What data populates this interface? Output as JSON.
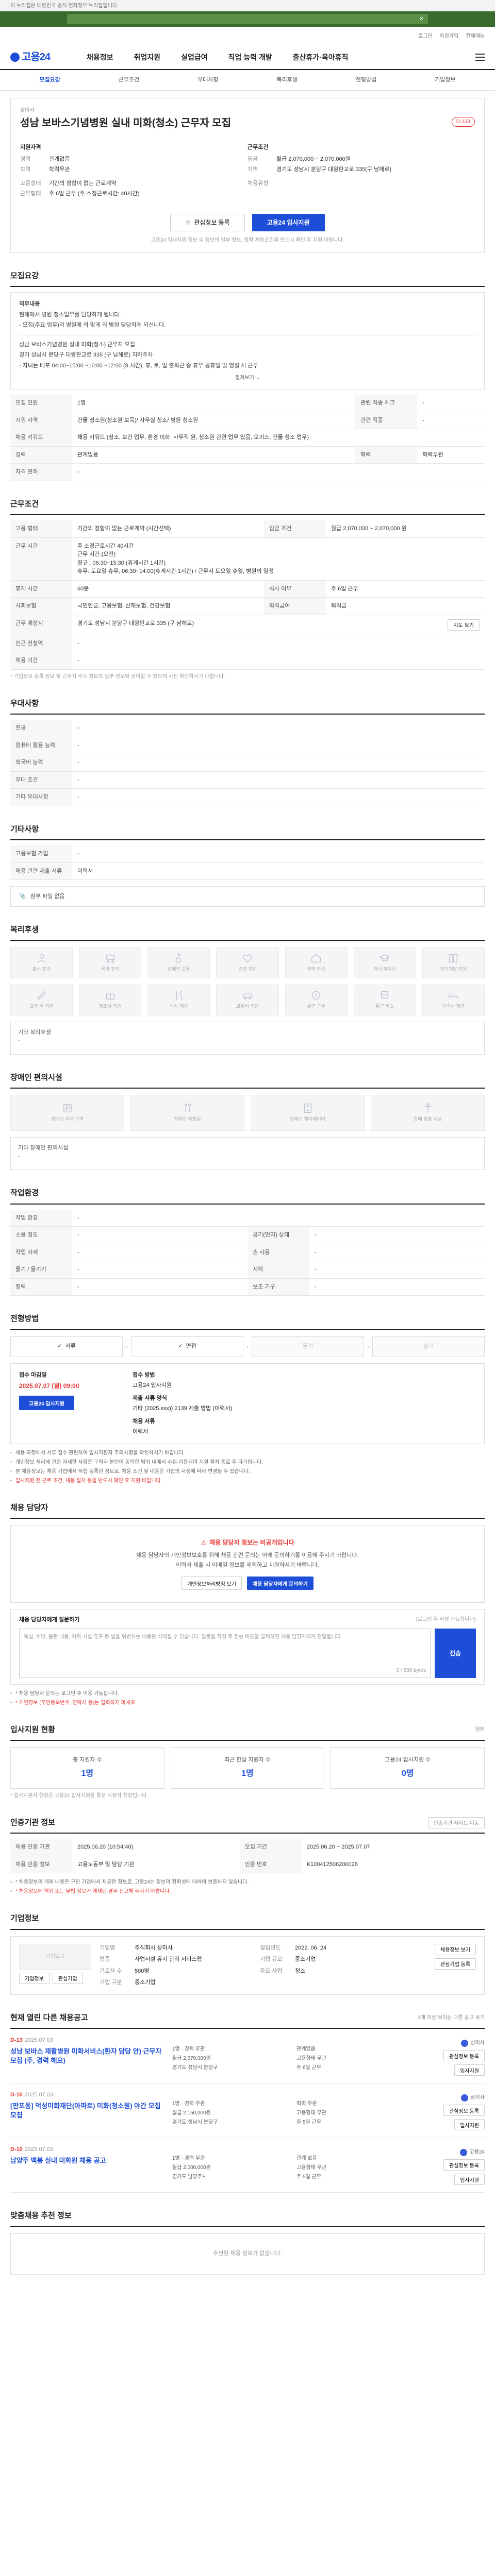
{
  "top_notice": "이 누리집은 대한민국 공식 전자정부 누리집입니다.",
  "utility": {
    "login": "로그인",
    "join": "회원가입",
    "site_map": "전체메뉴"
  },
  "header": {
    "logo": "고용24",
    "menu": [
      "채용정보",
      "취업지원",
      "실업급여",
      "직업 능력 개발",
      "출산휴가·육아휴직"
    ]
  },
  "tabnav": [
    "모집요강",
    "근무조건",
    "우대사항",
    "복리후생",
    "전형방법",
    "기업정보"
  ],
  "title": {
    "company": "상미사",
    "name": "성남 보바스기념병원 실내 미화(청소) 근무자 모집",
    "badge": "D-133",
    "left_head": "지원자격",
    "left": [
      {
        "k": "경력",
        "v": "관계없음"
      },
      {
        "k": "학력",
        "v": "학력무관"
      },
      {
        "k": "고용형태",
        "v": ""
      },
      {
        "k": "고용형태",
        "v": "기간의 정함이 없는 근로계약"
      },
      {
        "k": "근무형태",
        "v": "주 6일 근무 (주 소정근로시간: 40시간)"
      }
    ],
    "right_head": "근무조건",
    "right": [
      {
        "k": "임금",
        "v": "월급 2,070,000 ~ 2,070,000원"
      },
      {
        "k": "지역",
        "v": "경기도 성남시 분당구 대왕판교로 335(구 남해로)"
      },
      {
        "k": "채용유형",
        "v": ""
      }
    ],
    "btn_scrap": "관심정보 등록",
    "btn_apply": "고용24 입사지원",
    "note": "고용24 입사지원 정보 수 정보의 일부 정보, 정확 채용조건을 반드시 확인 후 지원 바랍니다."
  },
  "recruit": {
    "title": "모집요강",
    "desc_lines": [
      "직무내용",
      "현해에서 병원 청소업무를 담당하게 됩니다.",
      "- 모집(주요 업무)의 병원에 의 맞게 의 병원 담당하게 되신니다.",
      "",
      "성남 보바스기념병원 실내 미화(청소) 근무자 모집",
      "경기 성남시 분당구 대왕판교로 335 (구 남해로) 지하주차",
      "- 자녀는 배포 04:00~15:00 ~16:00 ~12:00 (8 시간), 휴, 토, 일 출퇴근 중 휴무 공휴일 및 명절 시 근무"
    ],
    "more": "펼쳐보기",
    "rows": [
      {
        "k": "모집 인원",
        "v": "1명",
        "k2": "관련 직종 체크",
        "v2": "-"
      },
      {
        "k": "지원 자격",
        "v": "건물 청소원(청소원 보육)/ 사무실 청소/ 병원 청소원",
        "k2": "관련 직종",
        "v2": "-"
      },
      {
        "k": "채용 키워드",
        "v": "채용 키워드 (청소, 보건 업무, 환경 미화, 사무직 원, 청소원 관련 업무 있음, 오피스, 건물 청소 업무)",
        "k2": "",
        "v2": ""
      },
      {
        "k": "경력",
        "v": "관계없음",
        "k2": "학력",
        "v2": "학력무관"
      },
      {
        "k": "자격 면허",
        "v": "-",
        "k2": "",
        "v2": ""
      }
    ]
  },
  "condition": {
    "title": "근무조건",
    "rows": [
      {
        "k": "고용 형태",
        "v": "기간의 정함이 없는 근로계약 (시간선택)",
        "k2": "임금 조건",
        "v2": "월급 2,070,000 ~ 2,070,000 원"
      },
      {
        "k": "근무 시간",
        "v": "주 소정근로시간 40시간\n근무 시간:(오전)\n정규 : 06:30~15:30 (휴게시간 1시간)\n휴무: 토요일 휴무, 06:30~14:00(휴게시간 1시간) / 근무시 토요일 휴일, 병원의 일정",
        "k2": "",
        "v2": ""
      },
      {
        "k": "휴게 시간",
        "v": "60분",
        "k2": "식사 여부",
        "v2": "주 6일 근무"
      },
      {
        "k": "사회보험",
        "v": "국민연금, 고용보험, 산재보험, 건강보험",
        "k2": "퇴직급여",
        "v2": "퇴직금"
      },
      {
        "k": "근무 예정지",
        "v": "경기도 성남시 분당구 대왕판교로 335 (구 남해로)",
        "k2": "",
        "v2": ""
      },
      {
        "k": "인근 전철역",
        "v": "-",
        "k2": "",
        "v2": ""
      },
      {
        "k": "채용 기간",
        "v": "-",
        "k2": "",
        "v2": ""
      }
    ],
    "map_btn": "지도 보기",
    "note": "* 기업정보 등록 정보 및 근무지 주소 정보의 일부 정보와 상이할 수 있으며 사전 확인하시기 바랍니다."
  },
  "prefer": {
    "title": "우대사항",
    "rows": [
      {
        "k": "전공",
        "v": "-"
      },
      {
        "k": "컴퓨터 활용 능력",
        "v": "-"
      },
      {
        "k": "외국어 능력",
        "v": "-"
      },
      {
        "k": "우대 조건",
        "v": "-"
      },
      {
        "k": "기타 우대사항",
        "v": "-"
      }
    ]
  },
  "etc": {
    "title": "기타사항",
    "rows": [
      {
        "k": "고용보험 가입",
        "v": "-"
      },
      {
        "k": "채용 관련 제출 서류",
        "v": "이력서"
      }
    ],
    "file_label": "첨부 파일 없음"
  },
  "welfare": {
    "title": "복리후생",
    "items": [
      "출산 휴가",
      "육아 휴직",
      "장애인 고용",
      "건강 검진",
      "주택 자금",
      "자녀 학자금",
      "자기개발 지원",
      "교육 비 지원",
      "경조사 지원",
      "식사 제공",
      "교통비 지원",
      "유연 근무",
      "통근 버스",
      "기숙사 제공"
    ],
    "etc_label": "기타 복리후생",
    "etc_value": "-"
  },
  "disabled": {
    "title": "장애인 편의시설",
    "items": [
      "장애인 주차 구역",
      "장애인 화장실",
      "장애인 엘리베이터",
      "장애 맞춤 시설"
    ],
    "etc_label": "기타 장애인 편의시설",
    "etc_value": "-"
  },
  "work_env": {
    "title": "작업환경",
    "rows": [
      {
        "k": "작업 환경",
        "v": "-",
        "k2": "",
        "v2": ""
      },
      {
        "k": "소음 정도",
        "v": "-",
        "k2": "공기(먼지) 상태",
        "v2": "-"
      },
      {
        "k": "작업 자세",
        "v": "-",
        "k2": "손 사용",
        "v2": "-"
      },
      {
        "k": "들기 / 옮기기",
        "v": "-",
        "k2": "시력",
        "v2": "-"
      },
      {
        "k": "청력",
        "v": "-",
        "k2": "보조 기구",
        "v2": "-"
      }
    ]
  },
  "process": {
    "title": "전형방법",
    "steps": [
      "서류",
      "면접",
      "필기",
      "실기"
    ],
    "apply_label": "접수 마감일",
    "deadline": "2025.07.07 (월) 09:00",
    "apply_btn": "고용24 입사지원",
    "method_label": "접수 방법",
    "method": "고용24 입사지원",
    "docs_label": "제출 서류 양식",
    "docs": "기타 (2025.xxx)) 2139 제출 방법 (이력서)",
    "form_label": "채용 서류",
    "form": "이력서",
    "guides": [
      "채용 과정에서 서류 접수 관련하여 입사지원자 주의사항을 확인하시기 바랍니다.",
      "개인정보 처리에 관한 자세한 사항은 구직자 본인이 동의한 범위 내에서 수집·이용되며 지원 절차 종료 후 파기됩니다.",
      "본 채용정보는 채용 기업에서 직접 등록한 정보로, 채용 조건 및 내용은 기업의 사정에 따라 변경될 수 있습니다.",
      "입사지원 전 근로 조건, 채용 절차 등을 반드시 확인 후 지원 바랍니다."
    ]
  },
  "contact": {
    "title": "채용 담당자",
    "warn": "채용 담당자 정보는 비공개입니다",
    "desc1": "채용 담당자의 개인정보보호를 위해 채용 관련 문의는 아래 문의하기를 이용해 주시기 바랍니다.",
    "desc2": "이력서 제출 시 이메일 정보를 제외하고 지원하시기 바랍니다.",
    "btn1": "개인정보처리방침 보기",
    "btn2": "채용 담당자에게 문의하기",
    "inquiry_label": "채용 담당자에게 질문하기",
    "inquiry_hint": "(로그인 후 작성 가능합니다)",
    "inquiry_placeholder": "욕설, 비방, 음란 내용, 허위 사실 유포 등 법을 위반하는 내용은 삭제될 수 있습니다. 질문을 작성 후 전송 버튼을 클릭하면 채용 담당자에게 전달됩니다.",
    "count": "0 / 500 bytes",
    "send": "전송",
    "notes": [
      "* 채용 담당자 문의는 로그인 후 이용 가능합니다.",
      "* 개인정보 (주민등록번호, 연락처 등)는 입력하지 마세요."
    ]
  },
  "status": {
    "title": "입사지원 현황",
    "aside": "현재",
    "cards": [
      {
        "label": "총 지원자 수",
        "value": "1명"
      },
      {
        "label": "최근 한달 지원자 수",
        "value": "1명"
      },
      {
        "label": "고용24 입사지원 수",
        "value": "0명"
      }
    ],
    "note": "* 입사지원자 현황은 고용24 입사지원을 통한 지원자 현황입니다."
  },
  "admin": {
    "title": "인증기관 정보",
    "aside": "인증기관 사이트 이동",
    "rows": [
      {
        "k": "채용 인증 기관",
        "v": "2025.06.20 (10:54:40)",
        "k2": "모집 기간",
        "v2": "2025.06.20 ~ 2025.07.07"
      },
      {
        "k": "채용 인증 정보",
        "v": "고용노동부 및 담당 기관",
        "k2": "인증 번호",
        "v2": "K120412506200028"
      }
    ],
    "notes": [
      "* 채용정보의 게재 내용은 구인 기업에서 제공한 정보로, 고용24는 정보의 정확성에 대하여 보증하지 않습니다.",
      "* 채용정보에 허위 또는 불법 정보가 게재된 경우 신고해 주시기 바랍니다."
    ]
  },
  "company": {
    "title": "기업정보",
    "logo_placeholder": "기업로고",
    "btn_a": "기업정보",
    "btn_b": "관심기업",
    "fields": [
      {
        "k": "기업명",
        "v": "주식회사 상미사"
      },
      {
        "k": "설립년도",
        "v": "2022. 06. 24"
      },
      {
        "k": "업종",
        "v": "사업시설 유지 관리 서비스업"
      },
      {
        "k": "기업 규모",
        "v": "중소기업"
      },
      {
        "k": "근로자 수",
        "v": "500명"
      },
      {
        "k": "주요 사업",
        "v": "청소"
      },
      {
        "k": "기업 구분",
        "v": "중소기업"
      },
      {
        "k": "",
        "v": ""
      }
    ],
    "side_btn1": "채용정보 보기",
    "side_btn2": "관심기업 등록"
  },
  "similar": {
    "title": "현재 열린 다른 채용공고",
    "aside": "1개 이상 보이는 다른 공고 보기",
    "items": [
      {
        "dday": "D-13",
        "date": "2025.07.03",
        "title": "성남 보바스 재활병원 미화서비스(환자 담당 안) 근무자 모집 (주, 경력 해요)",
        "meta": [
          "1명 · 경력 무관",
          "관계없음",
          "월급 2,070,000원",
          "고용형태 무관",
          "경기도 성남시 분당구",
          "주 6일 근무"
        ],
        "company": "상미사",
        "btn1": "관심정보 등록",
        "btn2": "입사지원"
      },
      {
        "dday": "D-10",
        "date": "2025.07.03",
        "title": "[판포동] 덕성미화재단(아파트) 미화(청소원) 야간 모집 모집",
        "meta": [
          "1명 · 경력 무관",
          "학력 무관",
          "월급 2,150,000원",
          "고용형태 무관",
          "경기도 성남시 분당구",
          "주 5일 근무"
        ],
        "company": "상미사",
        "btn1": "관심정보 등록",
        "btn2": "입사지원"
      },
      {
        "dday": "D-10",
        "date": "2025.07.03",
        "title": "남양주 백봉 실내 미화원 채용 공고",
        "meta": [
          "1명 · 경력 무관",
          "관계 없음",
          "월급 2,000,000원",
          "고용형태 무관",
          "경기도 남양주시",
          "주 5일 근무"
        ],
        "company": "고용24",
        "btn1": "관심정보 등록",
        "btn2": "입사지원"
      }
    ]
  },
  "recommend": {
    "title": "맞춤채용 추천 정보",
    "empty": "추천된 채용 정보가 없습니다."
  }
}
